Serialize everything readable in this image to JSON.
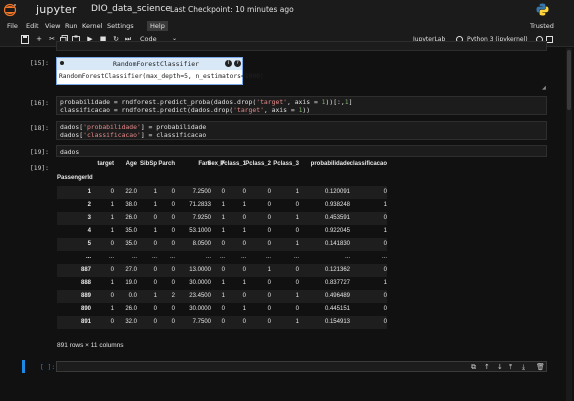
{
  "app": {
    "brand": "jupyter",
    "notebook_name": "DIO_data_science",
    "checkpoint": "Last Checkpoint: 10 minutes ago",
    "trusted": "Trusted"
  },
  "menu": [
    "File",
    "Edit",
    "View",
    "Run",
    "Kernel",
    "Settings",
    "Help"
  ],
  "toolbar": {
    "cell_type": "Code",
    "jupyterlab": "JupyterLab",
    "kernel": "Python 3 (ipykernel)"
  },
  "cells": {
    "c15_prompt": "[15]:",
    "c15_model_name": "RandomForestClassifier",
    "c15_model_params": "RandomForestClassifier(max_depth=5, n_estimators=1000)",
    "c16_prompt": "[16]:",
    "c16_line1_a": "probabilidade = rndforest.predict_proba(dados.drop(",
    "c16_line1_b": "'target'",
    "c16_line1_c": ", axis = ",
    "c16_line1_d": "1",
    "c16_line1_e": "))[:,",
    "c16_line1_f": "1",
    "c16_line1_g": "]",
    "c16_line2_a": "classificacao = rndforest.predict(dados.drop(",
    "c16_line2_b": "'target'",
    "c16_line2_c": ", axis = ",
    "c16_line2_d": "1",
    "c16_line2_e": "))",
    "c18_prompt": "[18]:",
    "c18_line1_a": "dados[",
    "c18_line1_b": "'probabilidade'",
    "c18_line1_c": "] = probabilidade",
    "c18_line2_a": "dados[",
    "c18_line2_b": "'classificacao'",
    "c18_line2_c": "] = classificacao",
    "c19_prompt": "[19]:",
    "c19_code": "dados",
    "c19_out_prompt": "[19]:",
    "empty_prompt": "[ ]:"
  },
  "dataframe": {
    "columns": [
      "target",
      "Age",
      "SibSp",
      "Parch",
      "Fare",
      "Sex_F",
      "Pclass_1",
      "Pclass_2",
      "Pclass_3",
      "probabilidade",
      "classificacao"
    ],
    "index_name": "PassengerId",
    "rows": [
      [
        "1",
        "0",
        "22.0",
        "1",
        "0",
        "7.2500",
        "0",
        "0",
        "0",
        "1",
        "0.120091",
        "0"
      ],
      [
        "2",
        "1",
        "38.0",
        "1",
        "0",
        "71.2833",
        "1",
        "1",
        "0",
        "0",
        "0.938248",
        "1"
      ],
      [
        "3",
        "1",
        "26.0",
        "0",
        "0",
        "7.9250",
        "1",
        "0",
        "0",
        "1",
        "0.453591",
        "0"
      ],
      [
        "4",
        "1",
        "35.0",
        "1",
        "0",
        "53.1000",
        "1",
        "1",
        "0",
        "0",
        "0.922045",
        "1"
      ],
      [
        "5",
        "0",
        "35.0",
        "0",
        "0",
        "8.0500",
        "0",
        "0",
        "0",
        "1",
        "0.141830",
        "0"
      ],
      [
        "...",
        "...",
        "...",
        "...",
        "...",
        "...",
        "...",
        "...",
        "...",
        "...",
        "...",
        "..."
      ],
      [
        "887",
        "0",
        "27.0",
        "0",
        "0",
        "13.0000",
        "0",
        "0",
        "1",
        "0",
        "0.121362",
        "0"
      ],
      [
        "888",
        "1",
        "19.0",
        "0",
        "0",
        "30.0000",
        "1",
        "1",
        "0",
        "0",
        "0.837727",
        "1"
      ],
      [
        "889",
        "0",
        "0.0",
        "1",
        "2",
        "23.4500",
        "1",
        "0",
        "0",
        "1",
        "0.496489",
        "0"
      ],
      [
        "890",
        "1",
        "26.0",
        "0",
        "0",
        "30.0000",
        "0",
        "1",
        "0",
        "0",
        "0.445151",
        "0"
      ],
      [
        "891",
        "0",
        "32.0",
        "0",
        "0",
        "7.7500",
        "0",
        "0",
        "0",
        "1",
        "0.154913",
        "0"
      ]
    ],
    "dims": "891 rows × 11 columns"
  }
}
